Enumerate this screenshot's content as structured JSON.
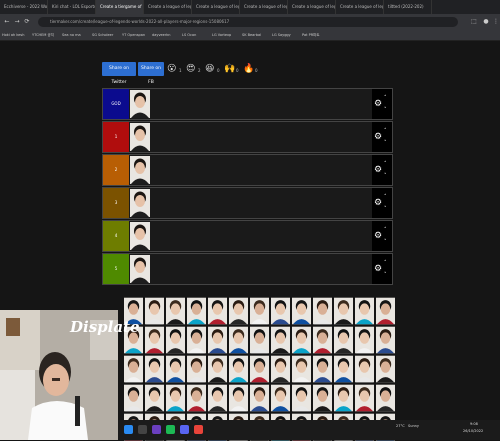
{
  "browser": {
    "tabs": [
      "Ecchiverse - 2022 Worlds",
      "Kiri chat - LOL Esports",
      "Create a tiergame of league",
      "Create a league of lego",
      "Create a league of lego",
      "Create a league of lego",
      "Create a league of lego",
      "Create a league of lego",
      "tiltted (2022-202)"
    ],
    "active_tab": 2,
    "url": "tiermaker.com/create/league-of-legends-worlds-2022-all-players-major-regions-15080617",
    "bookmarks": [
      "Hoki ah kesh",
      "YTCHEM 공지",
      "Sea no ma",
      "SG Scholeer",
      "YT Openspan",
      "dayveerkn",
      "LS Ocon",
      "LG Vortexp",
      "SK Bearbal",
      "LG Sayggy",
      "Pat PR파트"
    ]
  },
  "share": {
    "twitter": "Share on Twitter",
    "fb": "Share on FB"
  },
  "reactions": [
    {
      "icon": "😮",
      "count": "1"
    },
    {
      "icon": "😍",
      "count": "2"
    },
    {
      "icon": "😆",
      "count": "0"
    },
    {
      "icon": "🙌",
      "count": "0"
    },
    {
      "icon": "🔥",
      "count": "0"
    }
  ],
  "tiers": [
    {
      "label": "GOD",
      "color": "#0b0b8e"
    },
    {
      "label": "1",
      "color": "#b00d0d"
    },
    {
      "label": "2",
      "color": "#b85e04"
    },
    {
      "label": "3",
      "color": "#7b5200"
    },
    {
      "label": "4",
      "color": "#6e7d00"
    },
    {
      "label": "5",
      "color": "#4f8a00"
    }
  ],
  "overlay": {
    "brand": "Displate"
  },
  "taskbar": {
    "weather": "27°C",
    "weather_desc": "Sunny",
    "time": "9:08",
    "date": "26/10/2022"
  },
  "colors": {
    "page_bg": "#151515",
    "accent": "#2d6fd2"
  }
}
